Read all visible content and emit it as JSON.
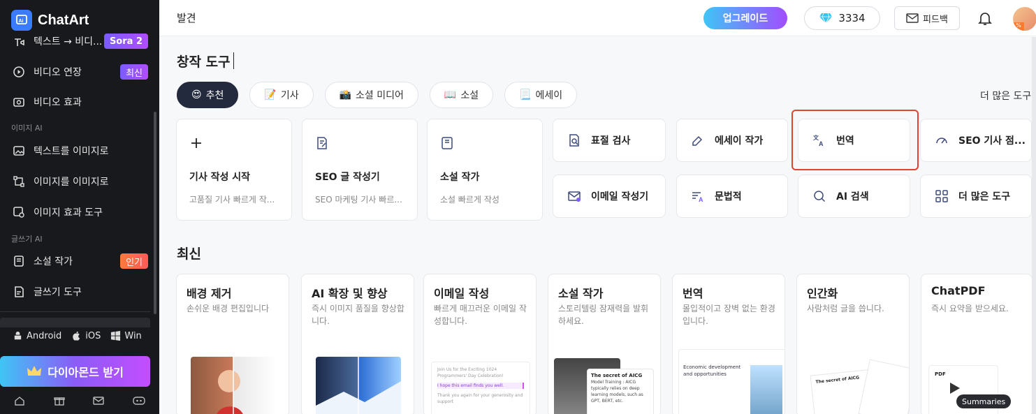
{
  "app": {
    "name": "ChatArt"
  },
  "sidebar": {
    "partial_item": {
      "label": "텍스트 → 비디...",
      "badge": "Sora 2"
    },
    "items_video": [
      {
        "label": "비디오 연장",
        "badge": "최신"
      },
      {
        "label": "비디오 효과"
      }
    ],
    "section_image": "이미지 AI",
    "items_image": [
      {
        "label": "텍스트를 이미지로"
      },
      {
        "label": "이미지를 이미지로"
      },
      {
        "label": "이미지 효과 도구"
      }
    ],
    "section_writing": "글쓰기 AI",
    "items_writing": [
      {
        "label": "소설 작가",
        "badge": "인기"
      },
      {
        "label": "글쓰기 도구"
      }
    ],
    "platforms": [
      "Android",
      "iOS",
      "Win"
    ],
    "diamond_button": "다이아몬드 받기"
  },
  "topbar": {
    "title": "발견",
    "upgrade": "업그레이드",
    "credits": "3334",
    "feedback": "피드백"
  },
  "creation": {
    "title": "창작 도구",
    "categories": [
      {
        "emoji": "😍",
        "label": "추천"
      },
      {
        "emoji": "📝",
        "label": "기사"
      },
      {
        "emoji": "📸",
        "label": "소셜 미디어"
      },
      {
        "emoji": "📖",
        "label": "소설"
      },
      {
        "emoji": "📃",
        "label": "에세이"
      }
    ],
    "more_link": "더 많은 도구",
    "big_tools": [
      {
        "title": "기사 작성 시작",
        "desc": "고품질 기사 빠르게 작..."
      },
      {
        "title": "SEO 글 작성기",
        "desc": "SEO 마케팅 기사 빠르..."
      },
      {
        "title": "소설 작가",
        "desc": "소설 빠르게 작성"
      }
    ],
    "small_tools": [
      {
        "label": "표절 검사"
      },
      {
        "label": "에세이 작가"
      },
      {
        "label": "번역"
      },
      {
        "label": "SEO 기사 점..."
      },
      {
        "label": "이메일 작성기"
      },
      {
        "label": "문법적"
      },
      {
        "label": "AI 검색"
      },
      {
        "label": "더 많은 도구"
      }
    ]
  },
  "recent": {
    "title": "최신",
    "cards": [
      {
        "title": "배경 제거",
        "desc": "손쉬운 배경 편집입니다"
      },
      {
        "title": "AI 확장 및 향상",
        "desc": "즉시 이미지 품질을 향상합니다."
      },
      {
        "title": "이메일 작성",
        "desc": "빠르게 매끄러운 이메일 작성합니다."
      },
      {
        "title": "소설 작가",
        "desc": "스토리텔링 잠재력을 발휘하세요."
      },
      {
        "title": "번역",
        "desc": "몰입적이고 장벽 없는 환경입니다."
      },
      {
        "title": "인간화",
        "desc": "사람처럼 글을 씁니다."
      },
      {
        "title": "ChatPDF",
        "desc": "즉시 요약을 받으세요."
      }
    ],
    "thumb_texts": {
      "email_line1": "Join Us for the Exciting 1024 Programmers' Day Celebration!",
      "email_highlight": "I hope this email finds you well.",
      "email_line3": "Thank you again for your generosity and support",
      "novel_title": "The secret of AICG",
      "novel_body": "Model Training : AICG typically relies on deep learning models, such as GPT, BERT, etc.",
      "translate_title": "Economic development and opportunities",
      "humanize_title": "The secret of AICG",
      "pdf_label": "PDF",
      "pdf_summaries": "Summaries"
    }
  },
  "colors": {
    "accent": "#3a7bff",
    "highlight_border": "#e0432f",
    "active_tab": "#232a3d"
  }
}
